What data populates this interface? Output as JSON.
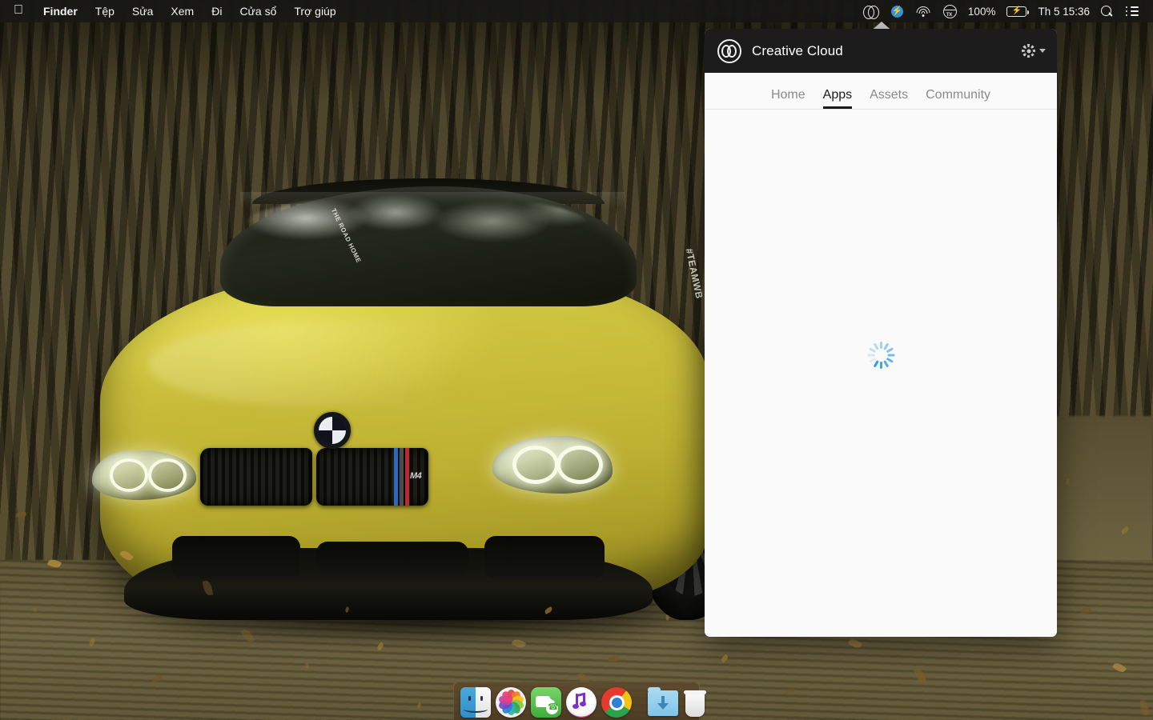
{
  "menubar": {
    "apple_icon": "apple-logo-icon",
    "items": [
      {
        "label": "Finder",
        "bold": true
      },
      {
        "label": "Tệp",
        "bold": false
      },
      {
        "label": "Sửa",
        "bold": false
      },
      {
        "label": "Xem",
        "bold": false
      },
      {
        "label": "Đi",
        "bold": false
      },
      {
        "label": "Cửa sổ",
        "bold": false
      },
      {
        "label": "Trợ giúp",
        "bold": false
      }
    ],
    "status": {
      "creative_cloud_icon": "creative-cloud-icon",
      "dropbox_icon": "dropbox-icon",
      "wifi_icon": "wifi-icon",
      "input_source_icon": "input-source-icon",
      "battery_percent": "100%",
      "battery_icon": "battery-charging-icon",
      "datetime": "Th 5 15:36",
      "search_icon": "spotlight-search-icon",
      "notification_icon": "notification-center-icon"
    }
  },
  "creative_cloud": {
    "title": "Creative Cloud",
    "logo_icon": "creative-cloud-logo-icon",
    "settings_icon": "gear-icon",
    "settings_caret_icon": "chevron-down-icon",
    "tabs": [
      {
        "label": "Home",
        "active": false
      },
      {
        "label": "Apps",
        "active": true
      },
      {
        "label": "Assets",
        "active": false
      },
      {
        "label": "Community",
        "active": false
      }
    ],
    "body": {
      "state": "loading",
      "spinner_icon": "loading-spinner-icon",
      "spinner_color": "#2f9fe0"
    },
    "header_bg": "#1c1c1c",
    "body_bg": "#fafafa"
  },
  "wallpaper": {
    "subject": "BMW M4 Austin Yellow on forest road",
    "car_color": "#c6ba38",
    "decal_left": "THE ROAD HOME",
    "decal_right": "#TEAMWB",
    "badge": "M4"
  },
  "dock": {
    "items": [
      {
        "name": "Finder",
        "icon": "finder-icon",
        "running": true
      },
      {
        "name": "Photos",
        "icon": "photos-icon",
        "running": false
      },
      {
        "name": "FaceTime",
        "icon": "facetime-icon",
        "running": false
      },
      {
        "name": "iTunes",
        "icon": "itunes-icon",
        "running": false
      },
      {
        "name": "Chrome",
        "icon": "chrome-icon",
        "running": true
      }
    ],
    "trailing": [
      {
        "name": "Downloads",
        "icon": "downloads-folder-icon"
      },
      {
        "name": "Trash",
        "icon": "trash-icon"
      }
    ]
  }
}
